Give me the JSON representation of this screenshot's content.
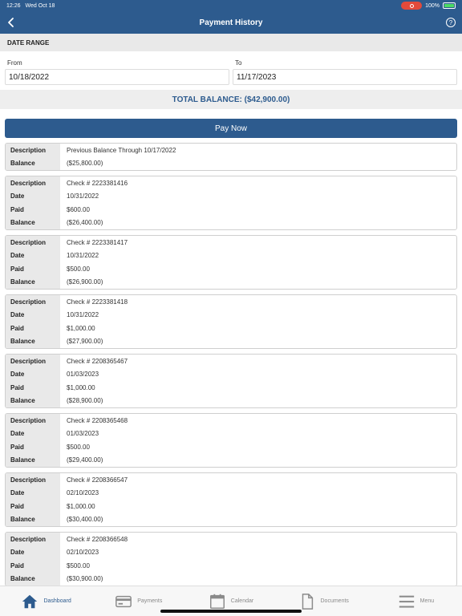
{
  "status": {
    "time": "12:26",
    "date": "Wed Oct 18",
    "battery": "100%"
  },
  "header": {
    "title": "Payment History",
    "help_symbol": "?"
  },
  "date_range": {
    "section_title": "DATE RANGE",
    "from_label": "From",
    "from_value": "10/18/2022",
    "to_label": "To",
    "to_value": "11/17/2023"
  },
  "total_balance": "TOTAL BALANCE: ($42,900.00)",
  "pay_now_label": "Pay Now",
  "records": [
    {
      "rows": [
        {
          "k": "Description",
          "v": "Previous Balance Through 10/17/2022"
        },
        {
          "k": "Balance",
          "v": "($25,800.00)"
        }
      ]
    },
    {
      "rows": [
        {
          "k": "Description",
          "v": "Check # 2223381416"
        },
        {
          "k": "Date",
          "v": "10/31/2022"
        },
        {
          "k": "Paid",
          "v": "$600.00"
        },
        {
          "k": "Balance",
          "v": "($26,400.00)"
        }
      ]
    },
    {
      "rows": [
        {
          "k": "Description",
          "v": "Check # 2223381417"
        },
        {
          "k": "Date",
          "v": "10/31/2022"
        },
        {
          "k": "Paid",
          "v": "$500.00"
        },
        {
          "k": "Balance",
          "v": "($26,900.00)"
        }
      ]
    },
    {
      "rows": [
        {
          "k": "Description",
          "v": "Check # 2223381418"
        },
        {
          "k": "Date",
          "v": "10/31/2022"
        },
        {
          "k": "Paid",
          "v": "$1,000.00"
        },
        {
          "k": "Balance",
          "v": "($27,900.00)"
        }
      ]
    },
    {
      "rows": [
        {
          "k": "Description",
          "v": "Check # 2208365467"
        },
        {
          "k": "Date",
          "v": "01/03/2023"
        },
        {
          "k": "Paid",
          "v": "$1,000.00"
        },
        {
          "k": "Balance",
          "v": "($28,900.00)"
        }
      ]
    },
    {
      "rows": [
        {
          "k": "Description",
          "v": "Check # 2208365468"
        },
        {
          "k": "Date",
          "v": "01/03/2023"
        },
        {
          "k": "Paid",
          "v": "$500.00"
        },
        {
          "k": "Balance",
          "v": "($29,400.00)"
        }
      ]
    },
    {
      "rows": [
        {
          "k": "Description",
          "v": "Check # 2208366547"
        },
        {
          "k": "Date",
          "v": "02/10/2023"
        },
        {
          "k": "Paid",
          "v": "$1,000.00"
        },
        {
          "k": "Balance",
          "v": "($30,400.00)"
        }
      ]
    },
    {
      "rows": [
        {
          "k": "Description",
          "v": "Check # 2208366548"
        },
        {
          "k": "Date",
          "v": "02/10/2023"
        },
        {
          "k": "Paid",
          "v": "$500.00"
        },
        {
          "k": "Balance",
          "v": "($30,900.00)"
        }
      ]
    }
  ],
  "tabs": [
    {
      "label": "Dashboard",
      "icon": "home-icon"
    },
    {
      "label": "Payments",
      "icon": "card-icon"
    },
    {
      "label": "Calendar",
      "icon": "calendar-icon"
    },
    {
      "label": "Documents",
      "icon": "document-icon"
    },
    {
      "label": "Menu",
      "icon": "menu-icon"
    }
  ],
  "colors": {
    "brand": "#2d5b8e",
    "row_label_bg": "#e9e9e9"
  }
}
